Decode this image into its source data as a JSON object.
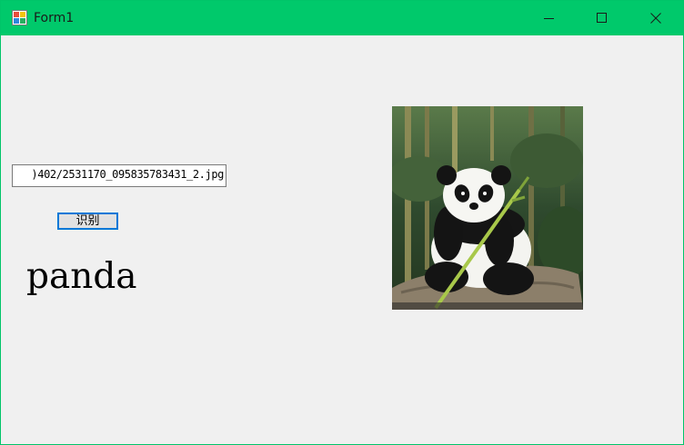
{
  "window": {
    "title": "Form1",
    "accent": "#00c96b"
  },
  "titlebar_controls": {
    "minimize_icon": "minimize-icon",
    "maximize_icon": "maximize-icon",
    "close_icon": "close-icon"
  },
  "form": {
    "path_value": ")402/2531170_095835783431_2.jpg",
    "recognize_label": "识别",
    "result_text": "panda",
    "picture_subject": "giant panda eating bamboo"
  }
}
